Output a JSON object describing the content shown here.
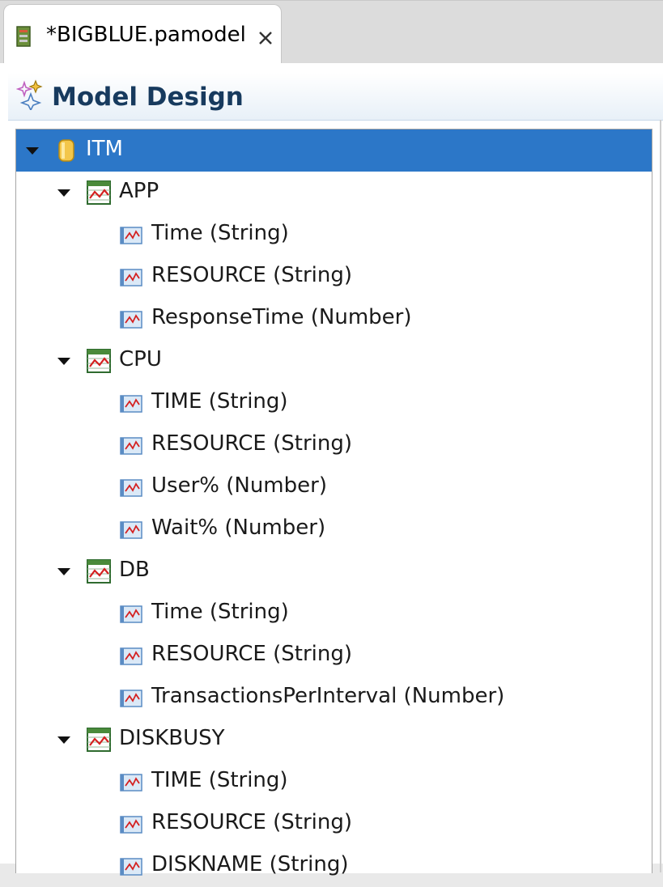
{
  "tab": {
    "title": "*BIGBLUE.pamodel",
    "file_icon": "pamodel-file-icon",
    "close_icon": "close-icon"
  },
  "header": {
    "title": "Model Design",
    "icon": "model-design-sparkle-icon"
  },
  "colors": {
    "selection": "#2c77c8",
    "header_title": "#173a5e",
    "tab_bar": "#dcdcdc"
  },
  "tree": {
    "root": {
      "label": "ITM",
      "icon": "database-icon",
      "expanded": true,
      "selected": true
    },
    "groups": [
      {
        "label": "APP",
        "icon": "table-chart-icon",
        "expanded": true,
        "fields": [
          "Time (String)",
          "RESOURCE (String)",
          "ResponseTime (Number)"
        ]
      },
      {
        "label": "CPU",
        "icon": "table-chart-icon",
        "expanded": true,
        "fields": [
          "TIME (String)",
          "RESOURCE (String)",
          "User% (Number)",
          "Wait% (Number)"
        ]
      },
      {
        "label": "DB",
        "icon": "table-chart-icon",
        "expanded": true,
        "fields": [
          "Time (String)",
          "RESOURCE (String)",
          "TransactionsPerInterval (Number)"
        ]
      },
      {
        "label": "DISKBUSY",
        "icon": "table-chart-icon",
        "expanded": true,
        "fields": [
          "TIME (String)",
          "RESOURCE (String)",
          "DISKNAME (String)"
        ]
      }
    ]
  }
}
